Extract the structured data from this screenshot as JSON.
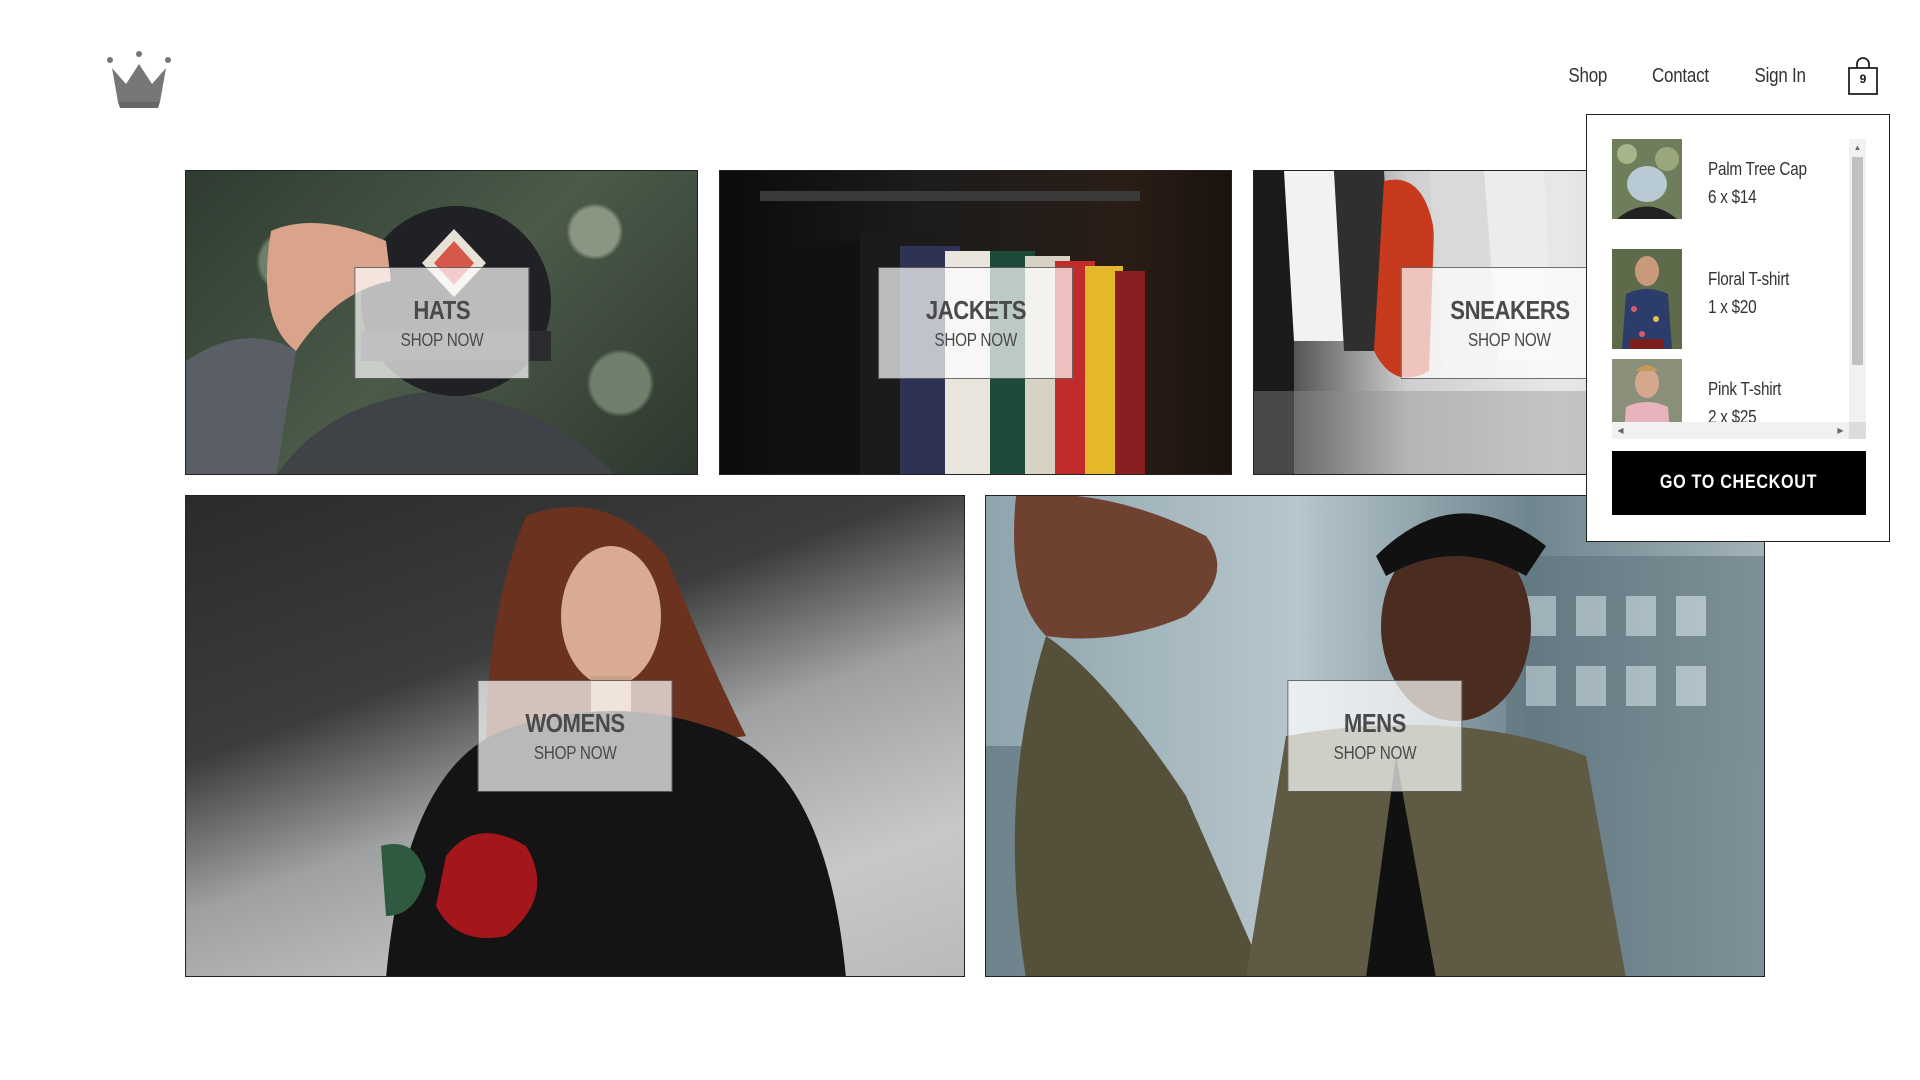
{
  "header": {
    "logo_icon": "crown-logo-icon",
    "nav": [
      {
        "label": "Shop"
      },
      {
        "label": "Contact"
      },
      {
        "label": "Sign In"
      }
    ],
    "cart": {
      "icon": "shopping-bag-icon",
      "count": "9"
    }
  },
  "directory": {
    "sections": [
      {
        "title": "HATS",
        "subtitle": "SHOP NOW"
      },
      {
        "title": "JACKETS",
        "subtitle": "SHOP NOW"
      },
      {
        "title": "SNEAKERS",
        "subtitle": "SHOP NOW"
      },
      {
        "title": "WOMENS",
        "subtitle": "SHOP NOW"
      },
      {
        "title": "MENS",
        "subtitle": "SHOP NOW"
      }
    ]
  },
  "cart_dropdown": {
    "items": [
      {
        "name": "Palm Tree Cap",
        "price": "6 x $14"
      },
      {
        "name": "Floral T-shirt",
        "price": "1 x $20"
      },
      {
        "name": "Pink T-shirt",
        "price": "2 x $25"
      }
    ],
    "checkout_label": "GO TO CHECKOUT"
  },
  "colors": {
    "accent": "#000000",
    "border": "#222222",
    "text": "#333333",
    "overlay": "#ffffffb3"
  }
}
